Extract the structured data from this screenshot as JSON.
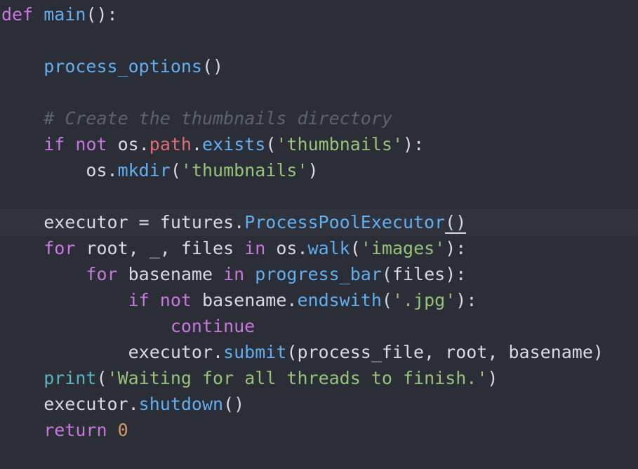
{
  "colors": {
    "background": "#2b2d37",
    "current_line": "#30323c",
    "keyword": "#c678dd",
    "function": "#61afef",
    "builtin": "#56b6c2",
    "attribute": "#e06c75",
    "string": "#98c379",
    "number": "#d19a66",
    "comment": "#5c6370",
    "text": "#d7dae0"
  },
  "code": {
    "lines": [
      [
        {
          "t": "kw",
          "v": "def"
        },
        {
          "t": "pl",
          "v": " "
        },
        {
          "t": "fn",
          "v": "main"
        },
        {
          "t": "pl",
          "v": "():"
        }
      ],
      [],
      [
        {
          "t": "pl",
          "v": "    "
        },
        {
          "t": "fn",
          "v": "process_options"
        },
        {
          "t": "pl",
          "v": "()"
        }
      ],
      [],
      [
        {
          "t": "pl",
          "v": "    "
        },
        {
          "t": "cm",
          "v": "# Create the thumbnails directory"
        }
      ],
      [
        {
          "t": "pl",
          "v": "    "
        },
        {
          "t": "kw",
          "v": "if"
        },
        {
          "t": "pl",
          "v": " "
        },
        {
          "t": "kw",
          "v": "not"
        },
        {
          "t": "pl",
          "v": " os."
        },
        {
          "t": "attr",
          "v": "path"
        },
        {
          "t": "pl",
          "v": "."
        },
        {
          "t": "fn",
          "v": "exists"
        },
        {
          "t": "pl",
          "v": "("
        },
        {
          "t": "str",
          "v": "'thumbnails'"
        },
        {
          "t": "pl",
          "v": "):"
        }
      ],
      [
        {
          "t": "pl",
          "v": "        os."
        },
        {
          "t": "fn",
          "v": "mkdir"
        },
        {
          "t": "pl",
          "v": "("
        },
        {
          "t": "str",
          "v": "'thumbnails'"
        },
        {
          "t": "pl",
          "v": ")"
        }
      ],
      [],
      [
        {
          "t": "pl",
          "v": "    executor = futures."
        },
        {
          "t": "fn",
          "v": "ProcessPoolExecutor"
        },
        {
          "t": "cursor",
          "v": "()"
        }
      ],
      [
        {
          "t": "pl",
          "v": "    "
        },
        {
          "t": "kw",
          "v": "for"
        },
        {
          "t": "pl",
          "v": " root, _, files "
        },
        {
          "t": "kw",
          "v": "in"
        },
        {
          "t": "pl",
          "v": " os."
        },
        {
          "t": "fn",
          "v": "walk"
        },
        {
          "t": "pl",
          "v": "("
        },
        {
          "t": "str",
          "v": "'images'"
        },
        {
          "t": "pl",
          "v": "):"
        }
      ],
      [
        {
          "t": "pl",
          "v": "        "
        },
        {
          "t": "kw",
          "v": "for"
        },
        {
          "t": "pl",
          "v": " basename "
        },
        {
          "t": "kw",
          "v": "in"
        },
        {
          "t": "pl",
          "v": " "
        },
        {
          "t": "fn",
          "v": "progress_bar"
        },
        {
          "t": "pl",
          "v": "(files):"
        }
      ],
      [
        {
          "t": "pl",
          "v": "            "
        },
        {
          "t": "kw",
          "v": "if"
        },
        {
          "t": "pl",
          "v": " "
        },
        {
          "t": "kw",
          "v": "not"
        },
        {
          "t": "pl",
          "v": " basename."
        },
        {
          "t": "fn",
          "v": "endswith"
        },
        {
          "t": "pl",
          "v": "("
        },
        {
          "t": "str",
          "v": "'.jpg'"
        },
        {
          "t": "pl",
          "v": "):"
        }
      ],
      [
        {
          "t": "pl",
          "v": "                "
        },
        {
          "t": "kw",
          "v": "continue"
        }
      ],
      [
        {
          "t": "pl",
          "v": "            executor."
        },
        {
          "t": "fn",
          "v": "submit"
        },
        {
          "t": "pl",
          "v": "(process_file, root, basename)"
        }
      ],
      [
        {
          "t": "pl",
          "v": "    "
        },
        {
          "t": "bi",
          "v": "print"
        },
        {
          "t": "pl",
          "v": "("
        },
        {
          "t": "str",
          "v": "'Waiting for all threads to finish.'"
        },
        {
          "t": "pl",
          "v": ")"
        }
      ],
      [
        {
          "t": "pl",
          "v": "    executor."
        },
        {
          "t": "fn",
          "v": "shutdown"
        },
        {
          "t": "pl",
          "v": "()"
        }
      ],
      [
        {
          "t": "pl",
          "v": "    "
        },
        {
          "t": "kw",
          "v": "return"
        },
        {
          "t": "pl",
          "v": " "
        },
        {
          "t": "num",
          "v": "0"
        }
      ]
    ],
    "current_line_index": 8
  }
}
